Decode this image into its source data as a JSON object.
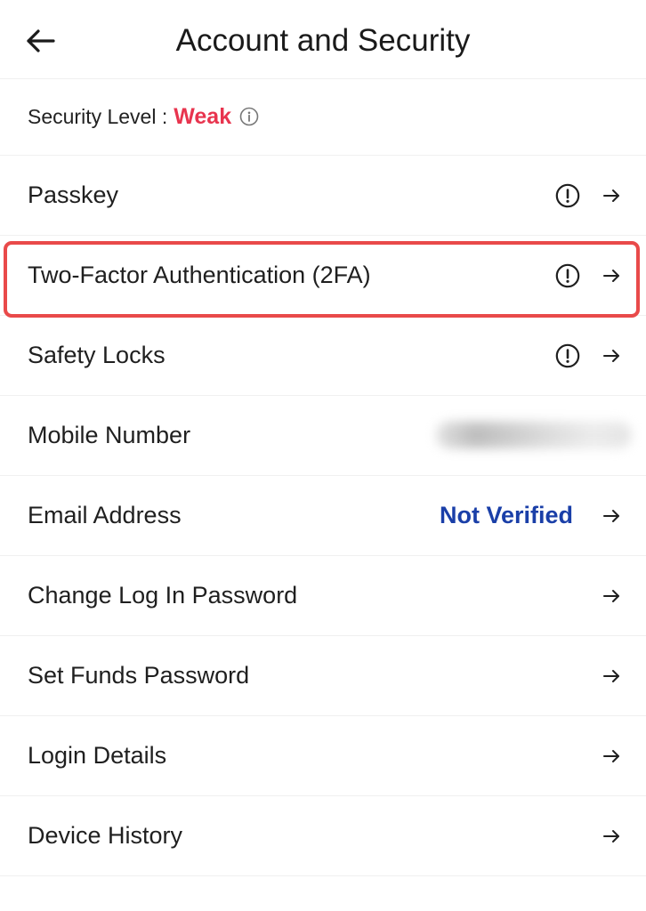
{
  "header": {
    "title": "Account and Security",
    "back_icon": "arrow-left-icon"
  },
  "security": {
    "label": "Security Level :",
    "value": "Weak",
    "value_color": "#e8344e",
    "info_icon": "info-circle-icon"
  },
  "rows": [
    {
      "label": "Passkey",
      "status_icon": "alert-circle-icon",
      "nav_icon": "arrow-right-icon"
    },
    {
      "label": "Two-Factor Authentication (2FA)",
      "status_icon": "alert-circle-icon",
      "nav_icon": "arrow-right-icon",
      "highlighted": true
    },
    {
      "label": "Safety Locks",
      "status_icon": "alert-circle-icon",
      "nav_icon": "arrow-right-icon"
    },
    {
      "label": "Mobile Number",
      "value_redacted": true
    },
    {
      "label": "Email Address",
      "value": "Not Verified",
      "value_color": "#1a3fa8",
      "nav_icon": "arrow-right-icon"
    },
    {
      "label": "Change Log In Password",
      "nav_icon": "arrow-right-icon"
    },
    {
      "label": "Set Funds Password",
      "nav_icon": "arrow-right-icon"
    },
    {
      "label": "Login Details",
      "nav_icon": "arrow-right-icon"
    },
    {
      "label": "Device History",
      "nav_icon": "arrow-right-icon"
    }
  ],
  "colors": {
    "highlight": "#e94a4a",
    "divider": "#f0f0f0"
  }
}
